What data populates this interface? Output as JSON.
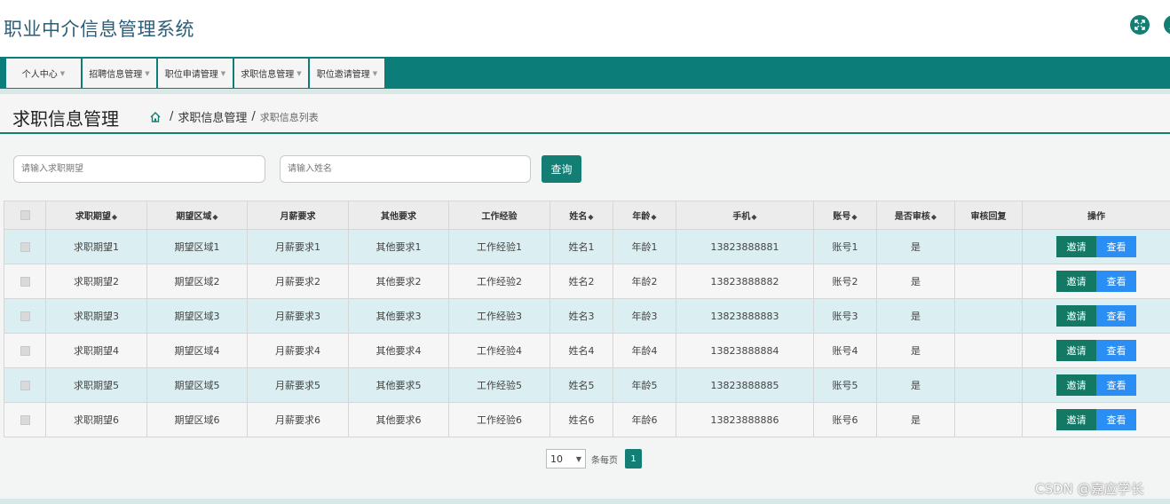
{
  "app": {
    "title": "职业中介信息管理系统"
  },
  "nav": {
    "items": [
      {
        "label": "个人中心"
      },
      {
        "label": "招聘信息管理"
      },
      {
        "label": "职位申请管理"
      },
      {
        "label": "求职信息管理"
      },
      {
        "label": "职位邀请管理"
      }
    ]
  },
  "page": {
    "title": "求职信息管理",
    "breadcrumb": {
      "sep1": "/",
      "section": "求职信息管理",
      "sep2": "/",
      "current": "求职信息列表"
    }
  },
  "search": {
    "expectation_placeholder": "请输入求职期望",
    "name_placeholder": "请输入姓名",
    "query_label": "查询"
  },
  "table": {
    "headers": {
      "expectation": "求职期望",
      "region": "期望区域",
      "salary": "月薪要求",
      "other": "其他要求",
      "experience": "工作经验",
      "name": "姓名",
      "age": "年龄",
      "phone": "手机",
      "account": "账号",
      "approved": "是否审核",
      "reply": "审核回复",
      "ops": "操作"
    },
    "sort_mark": "◆",
    "rows": [
      {
        "expectation": "求职期望1",
        "region": "期望区域1",
        "salary": "月薪要求1",
        "other": "其他要求1",
        "experience": "工作经验1",
        "name": "姓名1",
        "age": "年龄1",
        "phone": "13823888881",
        "account": "账号1",
        "approved": "是",
        "reply": ""
      },
      {
        "expectation": "求职期望2",
        "region": "期望区域2",
        "salary": "月薪要求2",
        "other": "其他要求2",
        "experience": "工作经验2",
        "name": "姓名2",
        "age": "年龄2",
        "phone": "13823888882",
        "account": "账号2",
        "approved": "是",
        "reply": ""
      },
      {
        "expectation": "求职期望3",
        "region": "期望区域3",
        "salary": "月薪要求3",
        "other": "其他要求3",
        "experience": "工作经验3",
        "name": "姓名3",
        "age": "年龄3",
        "phone": "13823888883",
        "account": "账号3",
        "approved": "是",
        "reply": ""
      },
      {
        "expectation": "求职期望4",
        "region": "期望区域4",
        "salary": "月薪要求4",
        "other": "其他要求4",
        "experience": "工作经验4",
        "name": "姓名4",
        "age": "年龄4",
        "phone": "13823888884",
        "account": "账号4",
        "approved": "是",
        "reply": ""
      },
      {
        "expectation": "求职期望5",
        "region": "期望区域5",
        "salary": "月薪要求5",
        "other": "其他要求5",
        "experience": "工作经验5",
        "name": "姓名5",
        "age": "年龄5",
        "phone": "13823888885",
        "account": "账号5",
        "approved": "是",
        "reply": ""
      },
      {
        "expectation": "求职期望6",
        "region": "期望区域6",
        "salary": "月薪要求6",
        "other": "其他要求6",
        "experience": "工作经验6",
        "name": "姓名6",
        "age": "年龄6",
        "phone": "13823888886",
        "account": "账号6",
        "approved": "是",
        "reply": ""
      }
    ],
    "actions": {
      "invite_label": "邀请",
      "view_label": "查看"
    }
  },
  "pager": {
    "page_size": "10",
    "per_page_label": "条每页",
    "current_page": "1"
  },
  "watermark": "CSDN @嘉应学长",
  "colors": {
    "primary": "#137f74",
    "invite": "#137965",
    "view": "#2b8ef5",
    "title": "#2d5e77"
  }
}
